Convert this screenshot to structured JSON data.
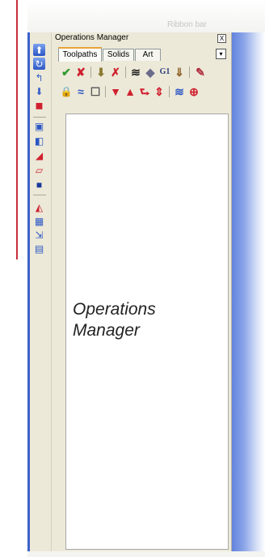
{
  "window": {
    "ribbon_label": "Ribbon bar",
    "panel_title": "Operations Manager",
    "close_glyph": "X",
    "dropdown_glyph": "▾"
  },
  "tabs": [
    {
      "label": "Toolpaths",
      "active": true
    },
    {
      "label": "Solids",
      "active": false
    },
    {
      "label": "Art",
      "active": false
    }
  ],
  "toolbar_row1": [
    {
      "name": "select-all-icon",
      "glyph": "✔"
    },
    {
      "name": "select-failed-icon",
      "glyph": "✘"
    },
    {
      "name": "regen-selected-icon",
      "glyph": "⬇"
    },
    {
      "name": "regen-dirty-icon",
      "glyph": "✗"
    },
    {
      "name": "verify-icon",
      "glyph": "≋"
    },
    {
      "name": "backplot-icon",
      "glyph": "◆"
    },
    {
      "name": "post-g1-icon",
      "glyph": "G1"
    },
    {
      "name": "highfeed-icon",
      "glyph": "⇓"
    },
    {
      "name": "delete-icon",
      "glyph": "✎"
    }
  ],
  "toolbar_row2": [
    {
      "name": "lock-icon",
      "glyph": "🔒"
    },
    {
      "name": "toggle-display-icon",
      "glyph": "≈"
    },
    {
      "name": "toggle-posting-icon",
      "glyph": "☐"
    },
    {
      "name": "move-down-icon",
      "glyph": "▼"
    },
    {
      "name": "move-up-icon",
      "glyph": "▲"
    },
    {
      "name": "insert-arrow-icon",
      "glyph": "⮑"
    },
    {
      "name": "scroll-icon",
      "glyph": "⇕"
    },
    {
      "name": "only-display-icon",
      "glyph": "≋"
    },
    {
      "name": "help-icon",
      "glyph": "⊕"
    }
  ],
  "left_tools": [
    {
      "name": "sidebar-tool-1-icon",
      "glyph": "⬆"
    },
    {
      "name": "sidebar-tool-2-icon",
      "glyph": "↻"
    },
    {
      "name": "sidebar-tool-3-icon",
      "glyph": "↰"
    },
    {
      "name": "sidebar-tool-4-icon",
      "glyph": "⬇"
    },
    {
      "name": "sidebar-tool-5-icon",
      "glyph": "◼"
    },
    {
      "name": "sidebar-tool-6-icon",
      "glyph": "▣"
    },
    {
      "name": "sidebar-tool-7-icon",
      "glyph": "◧"
    },
    {
      "name": "sidebar-tool-8-icon",
      "glyph": "◢"
    },
    {
      "name": "sidebar-tool-9-icon",
      "glyph": "▱"
    },
    {
      "name": "sidebar-tool-10-icon",
      "glyph": "■"
    },
    {
      "name": "sidebar-tool-11-icon",
      "glyph": "◭"
    },
    {
      "name": "sidebar-tool-12-icon",
      "glyph": "▦"
    },
    {
      "name": "sidebar-tool-13-icon",
      "glyph": "⇲"
    },
    {
      "name": "sidebar-tool-14-icon",
      "glyph": "▤"
    }
  ],
  "canvas_label_line1": "Operations",
  "canvas_label_line2": "Manager",
  "colors": {
    "accent_blue": "#3d62c9",
    "tab_highlight": "#e8a33a",
    "red_marker": "#c4303c",
    "green_check": "#2e9a2e"
  }
}
